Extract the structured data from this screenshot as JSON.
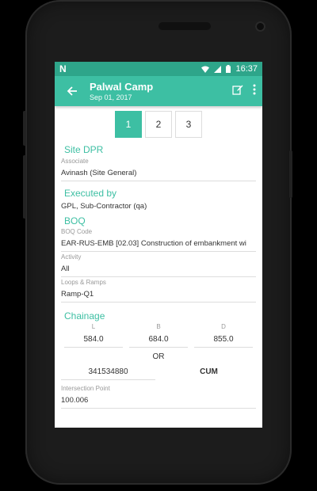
{
  "status_bar": {
    "left_icon": "n-icon",
    "time": "16:37"
  },
  "app_bar": {
    "title": "Palwal Camp",
    "subtitle": "Sep 01, 2017"
  },
  "pager": [
    "1",
    "2",
    "3"
  ],
  "pager_active_index": 0,
  "site_dpr": {
    "title": "Site DPR",
    "associate_label": "Associate",
    "associate_value": "Avinash (Site General)"
  },
  "executed_by": {
    "title": "Executed by",
    "value": "GPL, Sub-Contractor (qa)"
  },
  "boq": {
    "title": "BOQ",
    "code_label": "BOQ Code",
    "code_value": "EAR-RUS-EMB [02.03] Construction of embankment wi",
    "activity_label": "Activity",
    "activity_value": "All",
    "loops_label": "Loops & Ramps",
    "loops_value": "Ramp-Q1"
  },
  "chainage": {
    "title": "Chainage",
    "headers": [
      "L",
      "B",
      "D"
    ],
    "values": [
      "584.0",
      "684.0",
      "855.0"
    ],
    "or_label": "OR",
    "total": "341534880",
    "unit": "CUM",
    "intersection_label": "Intersection Point",
    "intersection_value": "100.006"
  },
  "colors": {
    "accent": "#3dbfa3",
    "status_bar": "#2ea58a"
  }
}
